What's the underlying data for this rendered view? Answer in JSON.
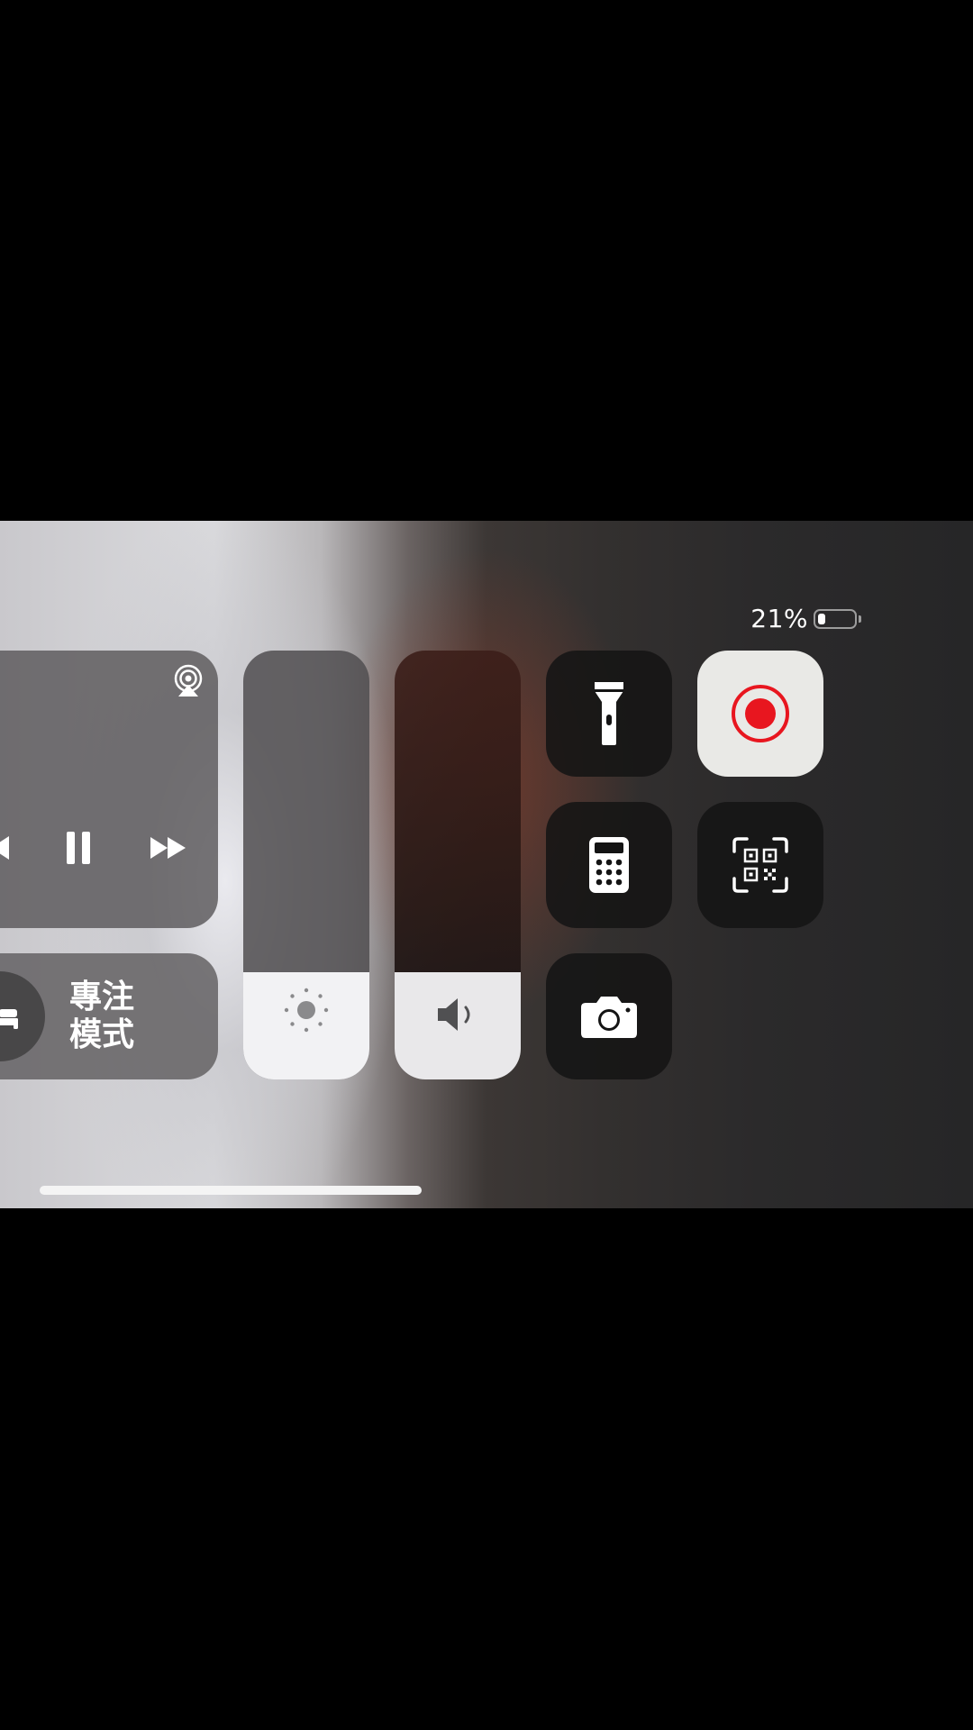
{
  "status": {
    "battery_text": "21%",
    "battery_level": 0.21
  },
  "media": {
    "icons": {
      "airplay": "airplay-icon",
      "previous": "backward-icon",
      "pause": "pause-icon",
      "next": "forward-icon"
    }
  },
  "focus": {
    "label": "專注\n模式",
    "icon": "bed-icon"
  },
  "sliders": {
    "brightness_level": 0.25,
    "volume_level": 0.25
  },
  "tiles": [
    "flashlight-icon",
    "screen-record-icon",
    "calculator-icon",
    "qr-scanner-icon",
    "camera-icon"
  ],
  "colors": {
    "record_red": "#e8161f",
    "tile_dark": "#141414"
  }
}
